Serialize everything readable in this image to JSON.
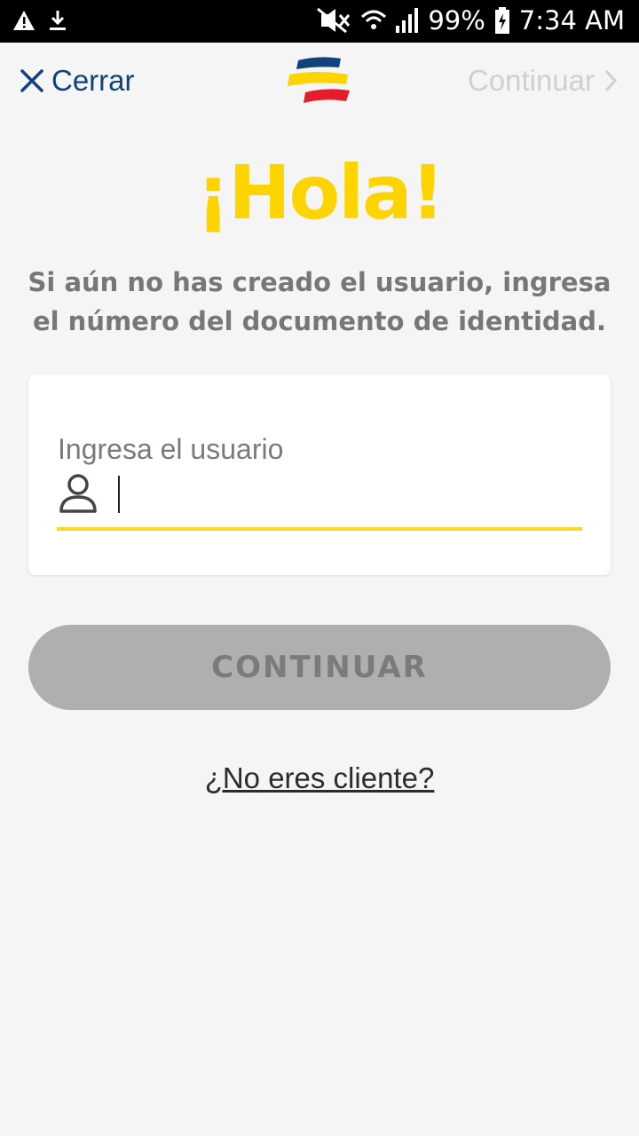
{
  "status_bar": {
    "battery_percent": "99%",
    "time": "7:34 AM",
    "icons": [
      "warning-icon",
      "download-icon",
      "mute-icon",
      "wifi-icon",
      "signal-icon",
      "battery-charging-icon"
    ]
  },
  "nav": {
    "close_label": "Cerrar",
    "continue_label": "Continuar",
    "logo": "bancolombia-logo",
    "accent_color": "#10427b"
  },
  "main": {
    "greeting": "¡Hola!",
    "subtitle": "Si aún no has creado el usuario, ingresa el número del documento de identidad.",
    "field": {
      "label": "Ingresa el usuario",
      "value": "",
      "icon": "user-icon"
    },
    "continue_button": "CONTINUAR",
    "not_client_link": "¿No eres cliente?"
  },
  "colors": {
    "brand_yellow": "#fdd300",
    "brand_blue": "#10427b",
    "brand_red": "#e41c2c",
    "disabled_button": "#adafb0"
  }
}
